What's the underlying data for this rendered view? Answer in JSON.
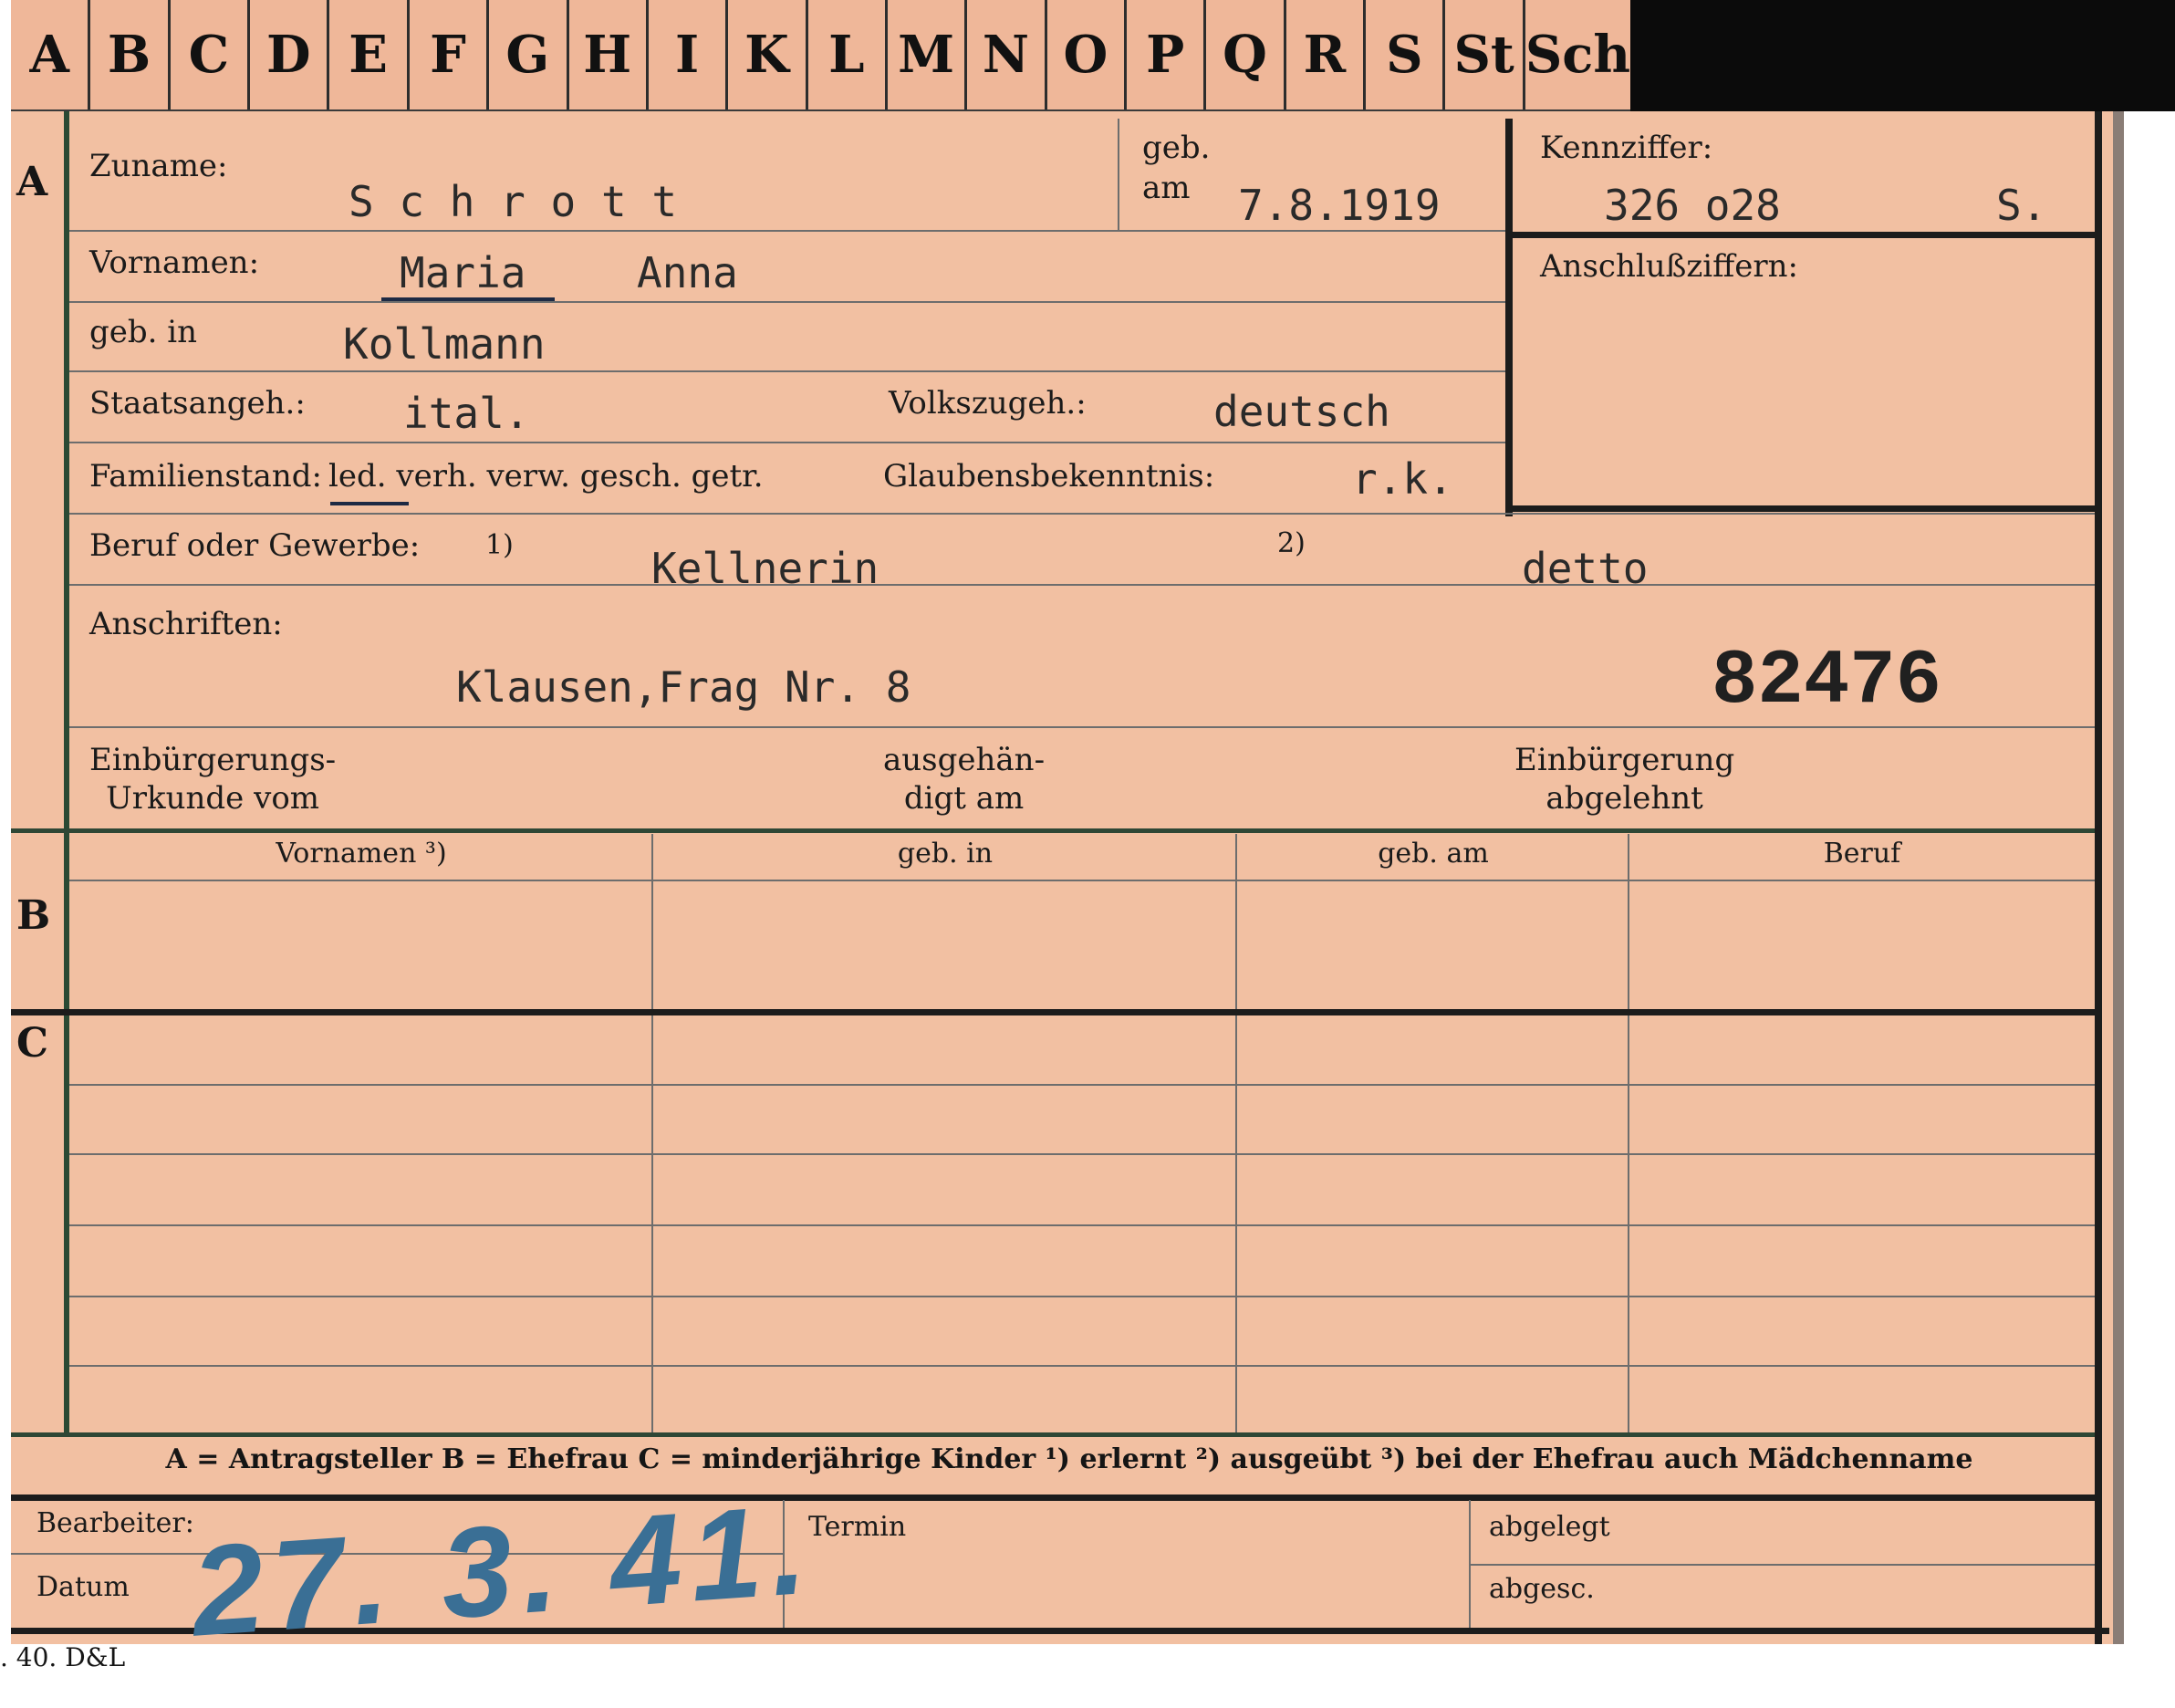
{
  "index_tabs": [
    "A",
    "B",
    "C",
    "D",
    "E",
    "F",
    "G",
    "H",
    "I",
    "K",
    "L",
    "M",
    "N",
    "O",
    "P",
    "Q",
    "R",
    "S",
    "St",
    "Sch"
  ],
  "section_a": {
    "marker": "A",
    "surname_label": "Zuname:",
    "surname_value": "S c h r o t t",
    "born_on_label_1": "geb.",
    "born_on_label_2": "am",
    "born_on_value": "7.8.1919",
    "kennziffer_label": "Kennziffer:",
    "kennziffer_value": "326 o28",
    "kennziffer_suffix": "S.",
    "anschluss_label": "Anschlußziffern:",
    "first_names_label": "Vornamen:",
    "first_name_1": "Maria",
    "first_name_2": "Anna",
    "born_in_label": "geb. in",
    "born_in_value": "Kollmann",
    "citizenship_label": "Staatsangeh.:",
    "citizenship_value": "ital.",
    "ethnicity_label": "Volkszugeh.:",
    "ethnicity_value": "deutsch",
    "marital_label": "Familienstand:",
    "marital_options": "led. verh. verw. gesch. getr.",
    "religion_label": "Glaubensbekenntnis:",
    "religion_value": "r.k.",
    "profession_label": "Beruf oder Gewerbe:",
    "profession_note_1": "1)",
    "profession_value_1": "Kellnerin",
    "profession_note_2": "2)",
    "profession_value_2": "detto",
    "address_label": "Anschriften:",
    "address_value": "Klausen,Frag Nr. 8",
    "file_number": "82476",
    "naturalization_cert_label_1": "Einbürgerungs-",
    "naturalization_cert_label_2": "Urkunde vom",
    "handed_label_1": "ausgehän-",
    "handed_label_2": "digt am",
    "rejected_label_1": "Einbürgerung",
    "rejected_label_2": "abgelehnt"
  },
  "section_b": {
    "marker": "B",
    "columns": [
      "Vornamen ³)",
      "geb. in",
      "geb. am",
      "Beruf"
    ]
  },
  "section_c": {
    "marker": "C"
  },
  "legend": "A = Antragsteller   B = Ehefrau   C = minderjährige Kinder   ¹) erlernt   ²) ausgeübt   ³) bei der Ehefrau auch Mädchenname",
  "footer": {
    "clerk_label": "Bearbeiter:",
    "date_label": "Datum",
    "date_stamp": "27. 3. 41.",
    "deadline_label": "Termin",
    "filed_label": "abgelegt",
    "sent_label": "abgesc.",
    "print_code": ". 40. D&L"
  },
  "colors": {
    "card": "#f2c0a2",
    "stamp_ink": "#3a6f95",
    "rule_green": "#2f4735"
  }
}
